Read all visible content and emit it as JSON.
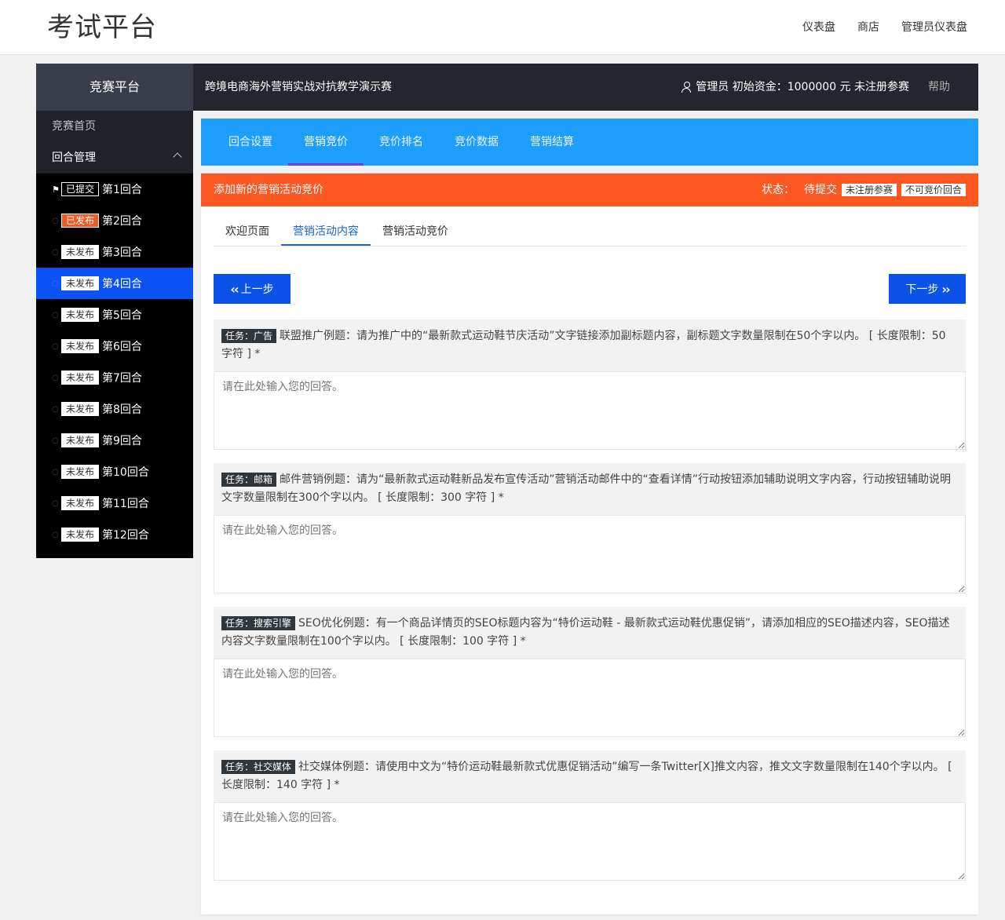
{
  "header": {
    "logo": "考试平台",
    "nav": [
      "仪表盘",
      "商店",
      "管理员仪表盘"
    ]
  },
  "sidebar": {
    "title": "竞赛平台",
    "home": "竞赛首页",
    "group": "回合管理",
    "rounds": [
      {
        "status": "已提交",
        "label": "第1回合",
        "kind": "submitted"
      },
      {
        "status": "已发布",
        "label": "第2回合",
        "kind": "published"
      },
      {
        "status": "未发布",
        "label": "第3回合",
        "kind": "unpub"
      },
      {
        "status": "未发布",
        "label": "第4回合",
        "kind": "unpub"
      },
      {
        "status": "未发布",
        "label": "第5回合",
        "kind": "unpub"
      },
      {
        "status": "未发布",
        "label": "第6回合",
        "kind": "unpub"
      },
      {
        "status": "未发布",
        "label": "第7回合",
        "kind": "unpub"
      },
      {
        "status": "未发布",
        "label": "第8回合",
        "kind": "unpub"
      },
      {
        "status": "未发布",
        "label": "第9回合",
        "kind": "unpub"
      },
      {
        "status": "未发布",
        "label": "第10回合",
        "kind": "unpub"
      },
      {
        "status": "未发布",
        "label": "第11回合",
        "kind": "unpub"
      },
      {
        "status": "未发布",
        "label": "第12回合",
        "kind": "unpub"
      }
    ]
  },
  "topbar": {
    "title": "跨境电商海外营销实战对抗教学演示赛",
    "user": "管理员 初始资金：1000000 元 未注册参赛",
    "help": "帮助"
  },
  "tabs": [
    "回合设置",
    "营销竞价",
    "竞价排名",
    "竞价数据",
    "营销结算"
  ],
  "panel": {
    "title": "添加新的营销活动竞价",
    "status_label": "状态：",
    "status_value": "待提交",
    "tags": [
      "未注册参赛",
      "不可竞价回合"
    ],
    "subtabs": [
      "欢迎页面",
      "营销活动内容",
      "营销活动竞价"
    ],
    "prev": "上一步",
    "next": "下一步",
    "placeholder": "请在此处输入您的回答。",
    "tasks": [
      {
        "tag": "任务：广告",
        "text": "联盟推广例题：请为推广中的“最新款式运动鞋节庆活动”文字链接添加副标题内容，副标题文字数量限制在50个字以内。 [ 长度限制：50 字符 ] *"
      },
      {
        "tag": "任务：邮箱",
        "text": "邮件营销例题：请为“最新款式运动鞋新品发布宣传活动”营销活动邮件中的“查看详情”行动按钮添加辅助说明文字内容，行动按钮辅助说明文字数量限制在300个字以内。 [ 长度限制：300 字符 ] *"
      },
      {
        "tag": "任务：搜索引擎",
        "text": "SEO优化例题：有一个商品详情页的SEO标题内容为“特价运动鞋 - 最新款式运动鞋优惠促销”，请添加相应的SEO描述内容，SEO描述内容文字数量限制在100个字以内。 [ 长度限制：100 字符 ] *"
      },
      {
        "tag": "任务：社交媒体",
        "text": "社交媒体例题：请使用中文为“特价运动鞋最新款式优惠促销活动”编写一条Twitter[X]推文内容，推文文字数量限制在140个字以内。 [ 长度限制：140 字符 ] *"
      }
    ]
  }
}
